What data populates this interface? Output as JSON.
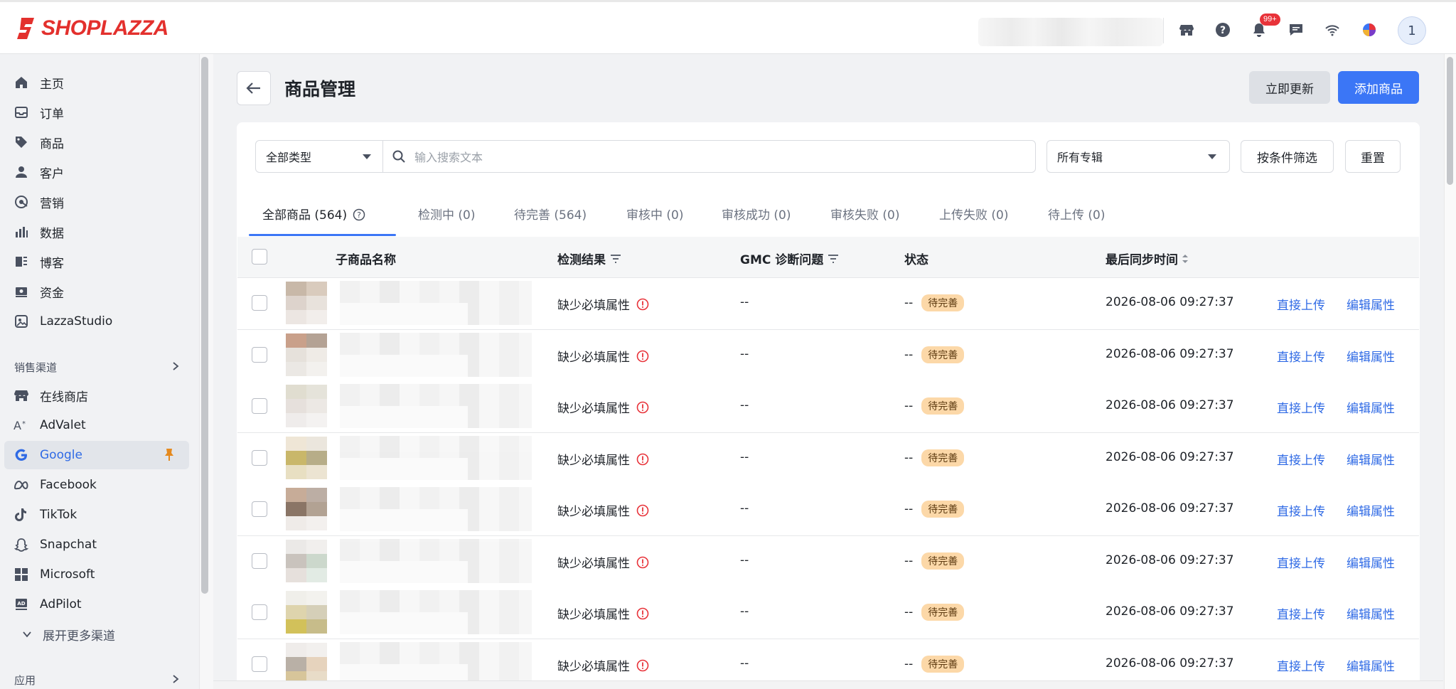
{
  "app": {
    "brand": "SHOPLAZZA",
    "brand_color": "#e3302d",
    "accent_color": "#3b76f6"
  },
  "topbar": {
    "notification_badge": "99+",
    "avatar_initial": "1",
    "icons": [
      "store-icon",
      "help-icon",
      "bell-icon",
      "chat-icon",
      "wifi-icon",
      "app-switch-icon"
    ]
  },
  "sidebar": {
    "main_items": [
      {
        "label": "主页",
        "icon": "home-icon"
      },
      {
        "label": "订单",
        "icon": "inbox-icon"
      },
      {
        "label": "商品",
        "icon": "tag-icon"
      },
      {
        "label": "客户",
        "icon": "person-icon"
      },
      {
        "label": "营销",
        "icon": "target-icon"
      },
      {
        "label": "数据",
        "icon": "bar-chart-icon"
      },
      {
        "label": "博客",
        "icon": "blog-icon"
      },
      {
        "label": "资金",
        "icon": "finance-icon"
      },
      {
        "label": "LazzaStudio",
        "icon": "studio-icon"
      }
    ],
    "channels_title": "销售渠道",
    "channels": [
      {
        "label": "在线商店",
        "icon": "store-icon"
      },
      {
        "label": "AdValet",
        "icon": "advalet-icon"
      },
      {
        "label": "Google",
        "icon": "google-icon",
        "active": true
      },
      {
        "label": "Facebook",
        "icon": "meta-icon"
      },
      {
        "label": "TikTok",
        "icon": "tiktok-icon"
      },
      {
        "label": "Snapchat",
        "icon": "snapchat-icon"
      },
      {
        "label": "Microsoft",
        "icon": "microsoft-icon"
      },
      {
        "label": "AdPilot",
        "icon": "adpilot-icon"
      }
    ],
    "expand_more": "展开更多渠道",
    "apps_title": "应用"
  },
  "page": {
    "title": "商品管理",
    "update_button": "立即更新",
    "add_button": "添加商品"
  },
  "filters": {
    "type_select": "全部类型",
    "search_placeholder": "输入搜索文本",
    "collection_select": "所有专辑",
    "filter_button": "按条件筛选",
    "reset_button": "重置"
  },
  "tabs": [
    {
      "label": "全部商品 (564)",
      "active": true
    },
    {
      "label": "检测中 (0)"
    },
    {
      "label": "待完善 (564)"
    },
    {
      "label": "审核中 (0)"
    },
    {
      "label": "审核成功 (0)"
    },
    {
      "label": "审核失败 (0)"
    },
    {
      "label": "上传失败 (0)"
    },
    {
      "label": "待上传 (0)"
    }
  ],
  "table": {
    "columns": {
      "name": "子商品名称",
      "detect": "检测结果",
      "gmc": "GMC 诊断问题",
      "status": "状态",
      "synced": "最后同步时间"
    },
    "rows": [
      {
        "detect": "缺少必填属性",
        "gmc": "--",
        "status_prefix": "--",
        "status": "待完善",
        "synced": "2026-08-06 09:27:37",
        "action1": "直接上传",
        "action2": "编辑属性",
        "thumb": [
          "#c8b8a8",
          "#d9cbbd",
          "#ddd3cc",
          "#e8e2dc",
          "#ece6e2",
          "#f2eeeb"
        ]
      },
      {
        "detect": "缺少必填属性",
        "gmc": "--",
        "status_prefix": "--",
        "status": "待完善",
        "synced": "2026-08-06 09:27:37",
        "action1": "直接上传",
        "action2": "编辑属性",
        "thumb": [
          "#c9a08a",
          "#b4a294",
          "#e6e1db",
          "#efebe6",
          "#ebe8e4",
          "#f3f1ee"
        ]
      },
      {
        "detect": "缺少必填属性",
        "gmc": "--",
        "status_prefix": "--",
        "status": "待完善",
        "synced": "2026-08-06 09:27:37",
        "action1": "直接上传",
        "action2": "编辑属性",
        "thumb": [
          "#e0ddd0",
          "#e5e3da",
          "#e6e0dc",
          "#ece8e4",
          "#efeceb",
          "#f4f2f1"
        ]
      },
      {
        "detect": "缺少必填属性",
        "gmc": "--",
        "status_prefix": "--",
        "status": "待完善",
        "synced": "2026-08-06 09:27:37",
        "action1": "直接上传",
        "action2": "编辑属性",
        "thumb": [
          "#efe6d6",
          "#ebe6dd",
          "#c9b76a",
          "#b7ad88",
          "#e8dfc2",
          "#ece4d2"
        ]
      },
      {
        "detect": "缺少必填属性",
        "gmc": "--",
        "status_prefix": "--",
        "status": "待完善",
        "synced": "2026-08-06 09:27:37",
        "action1": "直接上传",
        "action2": "编辑属性",
        "thumb": [
          "#c7ac98",
          "#bcaea4",
          "#8a7566",
          "#b2a293",
          "#efebe8",
          "#f3f0ee"
        ]
      },
      {
        "detect": "缺少必填属性",
        "gmc": "--",
        "status_prefix": "--",
        "status": "待完善",
        "synced": "2026-08-06 09:27:37",
        "action1": "直接上传",
        "action2": "编辑属性",
        "thumb": [
          "#ebe9e7",
          "#f1efed",
          "#c9c3bd",
          "#ccd8cc",
          "#e6e0dc",
          "#e2ebe4"
        ]
      },
      {
        "detect": "缺少必填属性",
        "gmc": "--",
        "status_prefix": "--",
        "status": "待完善",
        "synced": "2026-08-06 09:27:37",
        "action1": "直接上传",
        "action2": "编辑属性",
        "thumb": [
          "#f0efea",
          "#f3f2ee",
          "#ded4ad",
          "#d5cfb8",
          "#d2c15a",
          "#c7bc8a"
        ]
      },
      {
        "detect": "缺少必填属性",
        "gmc": "--",
        "status_prefix": "--",
        "status": "待完善",
        "synced": "2026-08-06 09:27:37",
        "action1": "直接上传",
        "action2": "编辑属性",
        "thumb": [
          "#efecea",
          "#f2f0ee",
          "#b9b0a6",
          "#e6d3bd",
          "#d7c59a",
          "#e8dcc8"
        ]
      }
    ]
  }
}
